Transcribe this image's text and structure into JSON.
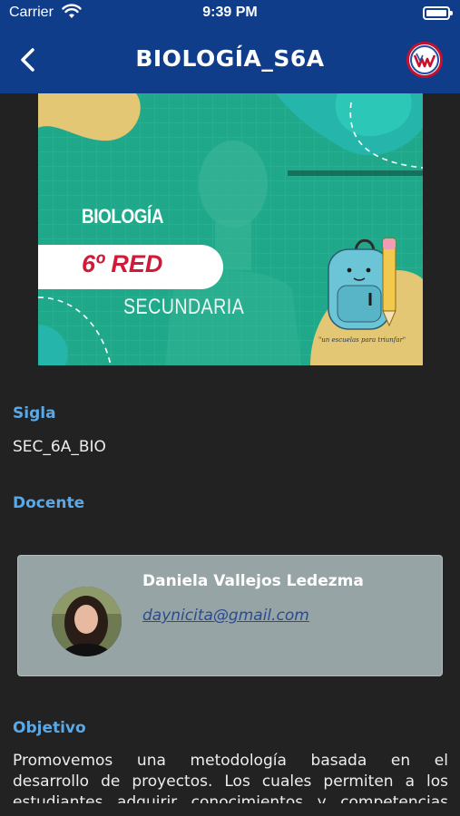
{
  "status_bar": {
    "carrier": "Carrier",
    "time": "9:39 PM"
  },
  "nav": {
    "title": "BIOLOGÍA_S6A"
  },
  "banner": {
    "subject": "BIOLOGÍA",
    "grade": "6º RED",
    "level": "SECUNDARIA",
    "slogan": "\"un escuelas para triunfar\""
  },
  "sections": {
    "sigla_label": "Sigla",
    "sigla_value": "SEC_6A_BIO",
    "docente_label": "Docente",
    "objetivo_label": "Objetivo"
  },
  "teacher": {
    "name": "Daniela Vallejos Ledezma",
    "email": "daynicita@gmail.com"
  },
  "objective": {
    "line1": "Promovemos una metodología basada en el",
    "line2": "desarrollo de proyectos. Los cuales permiten a los",
    "line3": "estudiantes adquirir conocimientos y competencias"
  },
  "colors": {
    "nav_bg": "#0f3d8a",
    "page_bg": "#222222",
    "section_label": "#5aa9e6",
    "card_bg": "#97a4a5",
    "banner_bg": "#1fa98a",
    "grade_red": "#d11a37"
  }
}
